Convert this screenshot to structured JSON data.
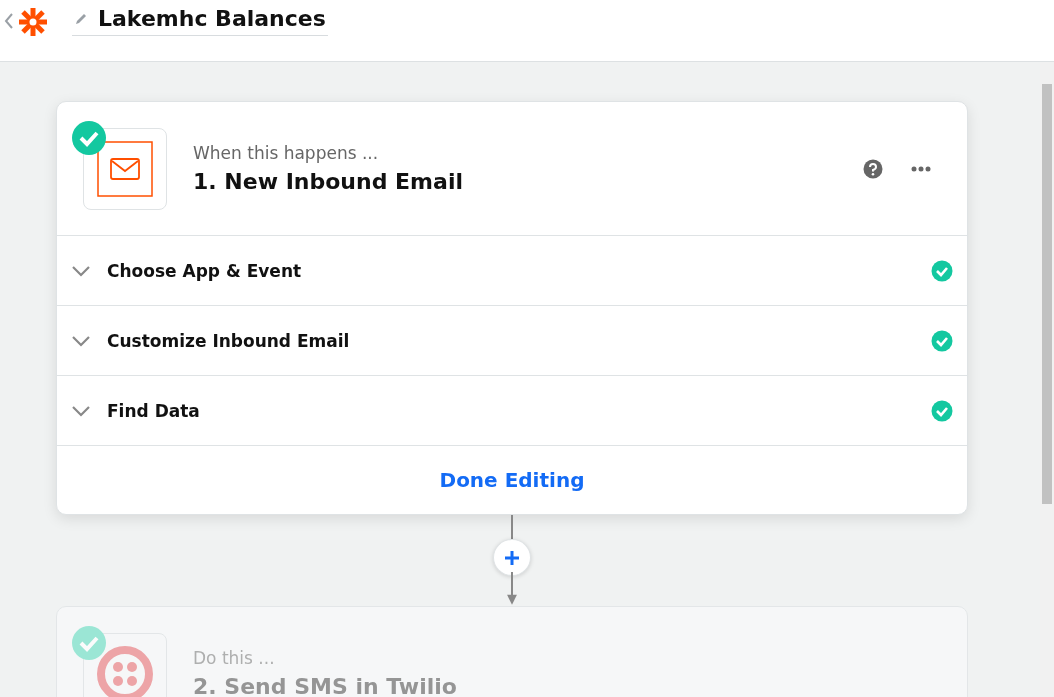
{
  "header": {
    "title": "Lakemhc Balances"
  },
  "steps": [
    {
      "kind": "trigger",
      "dimmed": false,
      "completed": true,
      "caption": "When this happens ...",
      "title": "1. New Inbound Email",
      "sections": [
        {
          "label": "Choose App & Event",
          "completed": true
        },
        {
          "label": "Customize Inbound Email",
          "completed": true
        },
        {
          "label": "Find Data",
          "completed": true
        }
      ],
      "done_button": "Done Editing"
    },
    {
      "kind": "action",
      "dimmed": true,
      "completed": true,
      "caption": "Do this ...",
      "title": "2. Send SMS in Twilio"
    }
  ]
}
